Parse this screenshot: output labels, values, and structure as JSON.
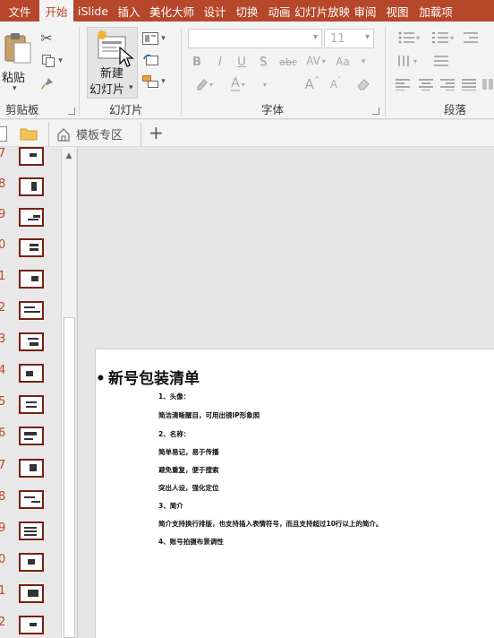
{
  "tabs": [
    {
      "label": "文件",
      "active": false,
      "w": 44
    },
    {
      "label": "开始",
      "active": true,
      "w": 38
    },
    {
      "label": "iSlide",
      "active": false,
      "w": 44
    },
    {
      "label": "插入",
      "active": false,
      "w": 36
    },
    {
      "label": "美化大师",
      "active": false,
      "w": 60
    },
    {
      "label": "设计",
      "active": false,
      "w": 36
    },
    {
      "label": "切换",
      "active": false,
      "w": 36
    },
    {
      "label": "动画",
      "active": false,
      "w": 36
    },
    {
      "label": "幻灯片放映",
      "active": false,
      "w": 60
    },
    {
      "label": "审阅",
      "active": false,
      "w": 36
    },
    {
      "label": "视图",
      "active": false,
      "w": 36
    },
    {
      "label": "加载项",
      "active": false,
      "w": 50
    }
  ],
  "ribbon": {
    "clipboard": {
      "paste_label": "粘贴",
      "group_label": "剪贴板"
    },
    "slides": {
      "new_slide_line1": "新建",
      "new_slide_line2": "幻灯片",
      "group_label": "幻灯片"
    },
    "font": {
      "size_value": "11",
      "group_label": "字体",
      "bold": "B",
      "italic": "I",
      "underline": "U",
      "shadow": "S",
      "strike": "abc",
      "spacing": "AV",
      "clear": "A",
      "grow": "A",
      "shrink": "A"
    },
    "paragraph": {
      "group_label": "段落"
    }
  },
  "doc_tab": {
    "label": "模板专区",
    "add": "+"
  },
  "thumbnails": [
    {
      "num": "7"
    },
    {
      "num": "8"
    },
    {
      "num": "9"
    },
    {
      "num": "0"
    },
    {
      "num": "1"
    },
    {
      "num": "2"
    },
    {
      "num": "3"
    },
    {
      "num": "4"
    },
    {
      "num": "5"
    },
    {
      "num": "6"
    },
    {
      "num": "7"
    },
    {
      "num": "8"
    },
    {
      "num": "9"
    },
    {
      "num": "0"
    },
    {
      "num": "1"
    },
    {
      "num": "2"
    }
  ],
  "slide": {
    "title": "新号包装清单",
    "lines": [
      "1、头像：",
      "简洁清晰醒目，可用出镜IP形象照",
      "2、名称：",
      "简单易记，易于传播",
      "避免重复，便于搜索",
      "突出人设，强化定位",
      "3、简介",
      "简介支持换行排版，也支持插入表情符号，而且支持超过10行以上的简介。",
      "4、账号拍摄布景调性"
    ]
  },
  "colors": {
    "accent": "#b7472a",
    "thumb_border": "#7a1f14",
    "ribbon_bg": "#f3f3f3"
  }
}
